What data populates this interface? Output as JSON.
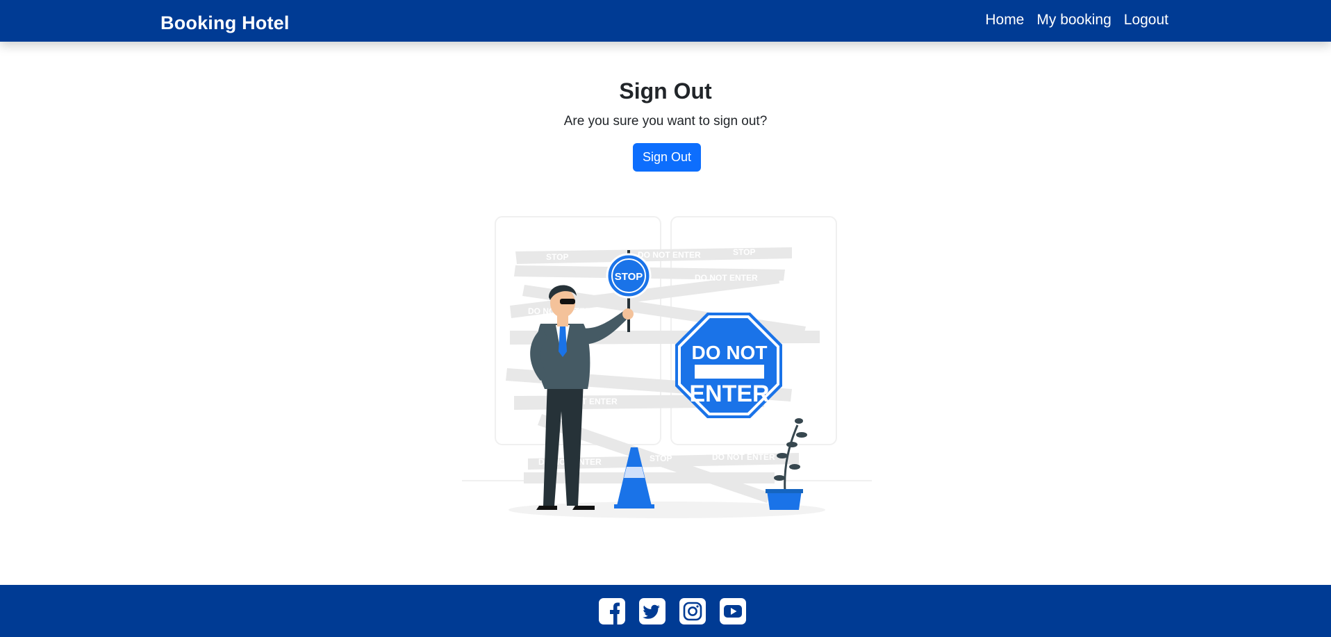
{
  "navbar": {
    "brand": "Booking Hotel",
    "links": [
      {
        "label": "Home"
      },
      {
        "label": "My booking"
      },
      {
        "label": "Logout"
      }
    ]
  },
  "main": {
    "title": "Sign Out",
    "prompt": "Are you sure you want to sign out?",
    "button_label": "Sign Out"
  },
  "illustration": {
    "sign_top": "DO NOT",
    "sign_bottom": "ENTER",
    "stop_paddle": "STOP",
    "tape_texts": [
      "STOP",
      "DO NOT ENTER"
    ]
  },
  "footer": {
    "socials": [
      "facebook-icon",
      "twitter-icon",
      "instagram-icon",
      "youtube-icon"
    ]
  },
  "colors": {
    "nav_bg": "#003b94",
    "primary": "#0d6efd",
    "illustration_blue": "#1a73e8"
  }
}
